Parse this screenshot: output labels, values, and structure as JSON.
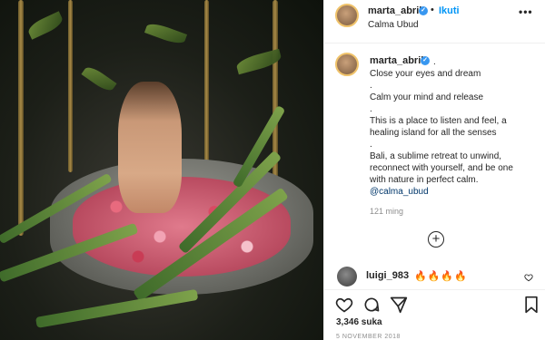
{
  "post": {
    "username": "marta_abril",
    "follow_label": "Ikuti",
    "location": "Calma Ubud",
    "more_label": "•••"
  },
  "caption": {
    "username": "marta_abril",
    "lines": [
      ".",
      "Close your eyes and dream",
      ".",
      "Calm your mind and release",
      ".",
      "This is a place to listen and feel, a",
      "healing island for all the senses",
      ".",
      "Bali, a sublime retreat to unwind,",
      "reconnect with yourself, and be one",
      "with nature in perfect calm."
    ],
    "mention": "@calma_ubud",
    "age": "121 ming"
  },
  "comment": {
    "username": "luigi_983",
    "text": "🔥🔥🔥🔥"
  },
  "engagement": {
    "likes": "3,346 suka",
    "date": "5 NOVEMBER 2018"
  },
  "icons": {
    "verified": "verified-badge-icon",
    "heart": "heart-icon",
    "comment": "comment-icon",
    "share": "share-icon",
    "save": "bookmark-icon",
    "load_more": "plus-circle-icon"
  },
  "colors": {
    "link": "#0095f6",
    "verified": "#3897f0",
    "mention": "#00376b"
  }
}
